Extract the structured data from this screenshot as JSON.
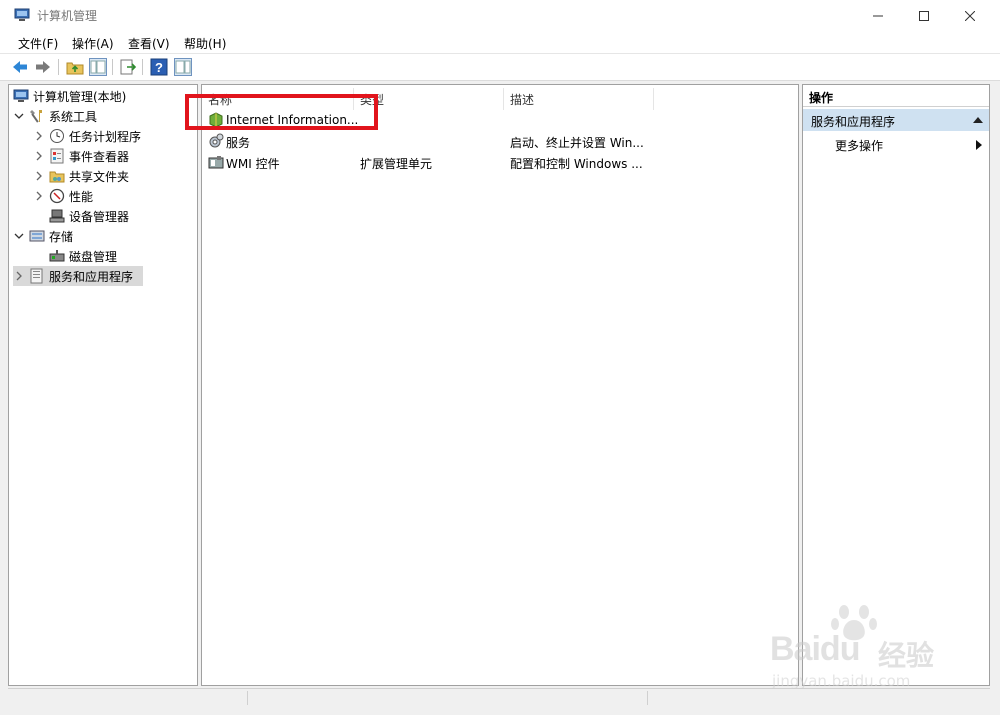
{
  "window": {
    "title": "计算机管理"
  },
  "menu": {
    "items": [
      {
        "label": "文件(F)"
      },
      {
        "label": "操作(A)"
      },
      {
        "label": "查看(V)"
      },
      {
        "label": "帮助(H)"
      }
    ]
  },
  "toolbar": {
    "icons": [
      "back-icon",
      "forward-icon",
      "up-folder-icon",
      "show-hide-tree-icon",
      "export-list-icon",
      "help-icon",
      "show-hide-action-pane-icon"
    ]
  },
  "tree": {
    "root": {
      "label": "计算机管理(本地)"
    },
    "system_tools": {
      "label": "系统工具",
      "children": [
        {
          "label": "任务计划程序"
        },
        {
          "label": "事件查看器"
        },
        {
          "label": "共享文件夹"
        },
        {
          "label": "性能"
        },
        {
          "label": "设备管理器"
        }
      ]
    },
    "storage": {
      "label": "存储",
      "children": [
        {
          "label": "磁盘管理"
        }
      ]
    },
    "services_apps": {
      "label": "服务和应用程序"
    }
  },
  "list": {
    "columns": [
      {
        "label": "名称"
      },
      {
        "label": "类型"
      },
      {
        "label": "描述"
      }
    ],
    "rows": [
      {
        "name": "Internet Information...",
        "type": "",
        "description": ""
      },
      {
        "name": "服务",
        "type": "",
        "description": "启动、终止并设置 Win..."
      },
      {
        "name": "WMI 控件",
        "type": "扩展管理单元",
        "description": "配置和控制 Windows ..."
      }
    ]
  },
  "actions": {
    "header": "操作",
    "section": "服务和应用程序",
    "items": [
      {
        "label": "更多操作"
      }
    ]
  },
  "watermark": {
    "brand": "Bai",
    "brand2": "du",
    "suffix": "经验",
    "url": "jingyan.baidu.com"
  },
  "colors": {
    "highlight": "#e1141c",
    "section_bg": "#cfe1f1",
    "selected_bg": "#d9d9d9"
  }
}
